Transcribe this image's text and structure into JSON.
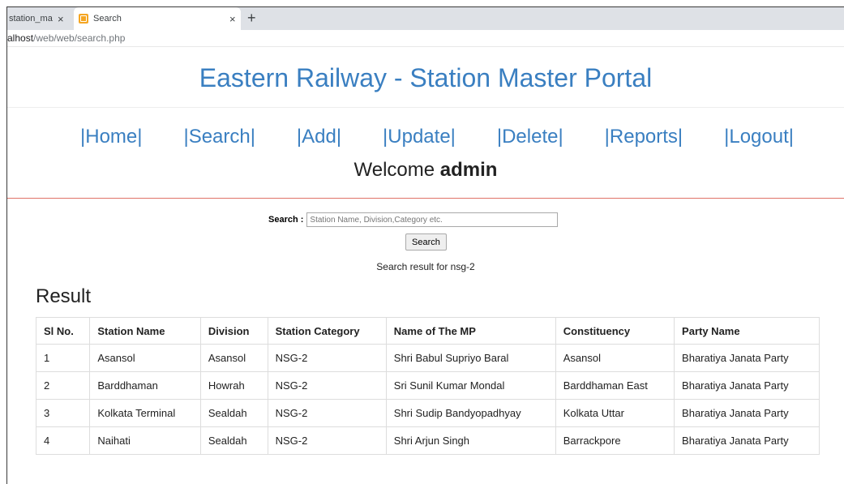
{
  "browser": {
    "tabs": [
      {
        "title": "station_ma",
        "close": "×"
      },
      {
        "title": "Search",
        "close": "×"
      }
    ],
    "new_tab": "+",
    "url_host": "alhost",
    "url_path": "/web/web/search.php"
  },
  "header": {
    "title": "Eastern Railway - Station Master Portal"
  },
  "nav": {
    "items": [
      "|Home|",
      "|Search|",
      "|Add|",
      "|Update|",
      "|Delete|",
      "|Reports|",
      "|Logout|"
    ]
  },
  "welcome": {
    "prefix": "Welcome ",
    "user": "admin"
  },
  "search": {
    "label": "Search :",
    "placeholder": "Station Name, Division,Category etc.",
    "button": "Search",
    "result_text": "Search result for nsg-2"
  },
  "result": {
    "heading": "Result",
    "columns": [
      "Sl No.",
      "Station Name",
      "Division",
      "Station Category",
      "Name of The MP",
      "Constituency",
      "Party Name"
    ],
    "rows": [
      [
        "1",
        "Asansol",
        "Asansol",
        "NSG-2",
        "Shri Babul Supriyo Baral",
        "Asansol",
        "Bharatiya Janata Party"
      ],
      [
        "2",
        "Barddhaman",
        "Howrah",
        "NSG-2",
        "Sri Sunil Kumar Mondal",
        "Barddhaman East",
        "Bharatiya Janata Party"
      ],
      [
        "3",
        "Kolkata Terminal",
        "Sealdah",
        "NSG-2",
        "Shri Sudip Bandyopadhyay",
        "Kolkata Uttar",
        "Bharatiya Janata Party"
      ],
      [
        "4",
        "Naihati",
        "Sealdah",
        "NSG-2",
        "Shri Arjun Singh",
        "Barrackpore",
        "Bharatiya Janata Party"
      ]
    ]
  },
  "colors": {
    "title_blue": "#3a7fc1",
    "divider_red": "#e07368"
  },
  "icons": {
    "tab_favicon": "xampp-icon",
    "close": "close-icon",
    "new_tab": "plus-icon"
  }
}
